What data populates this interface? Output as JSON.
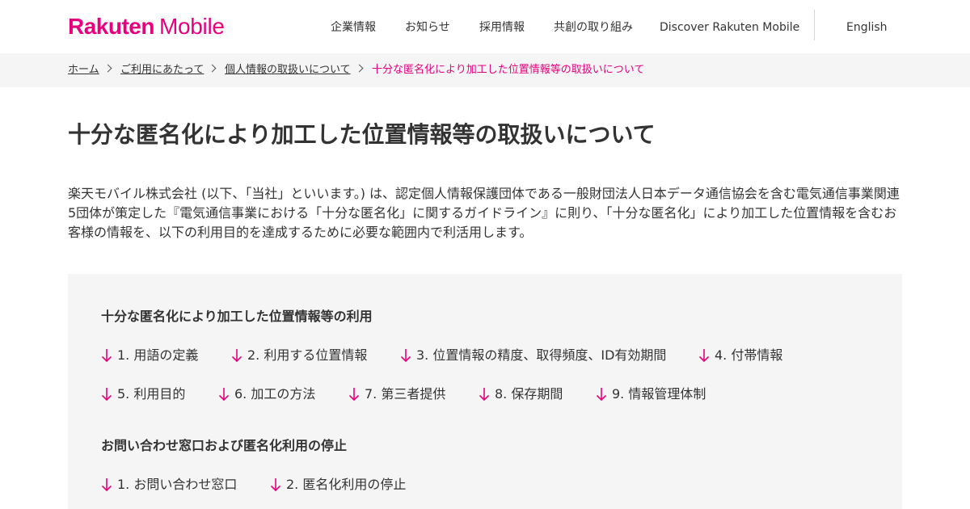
{
  "header": {
    "logo_brand": "Rakuten",
    "logo_product": "Mobile",
    "nav": [
      {
        "label": "企業情報"
      },
      {
        "label": "お知らせ"
      },
      {
        "label": "採用情報"
      },
      {
        "label": "共創の取り組み"
      },
      {
        "label": "Discover Rakuten Mobile"
      },
      {
        "label": "English"
      }
    ]
  },
  "breadcrumb": {
    "items": [
      {
        "label": "ホーム"
      },
      {
        "label": "ご利用にあたって"
      },
      {
        "label": "個人情報の取扱いについて"
      }
    ],
    "current": "十分な匿名化により加工した位置情報等の取扱いについて"
  },
  "page": {
    "title": "十分な匿名化により加工した位置情報等の取扱いについて",
    "intro": "楽天モバイル株式会社 (以下、「当社」といいます。) は、認定個人情報保護団体である一般財団法人日本データ通信協会を含む電気通信事業関連5団体が策定した『電気通信事業における「十分な匿名化」に関するガイドライン』に則り、「十分な匿名化」により加工した位置情報を含むお客様の情報を、以下の利用目的を達成するために必要な範囲内で利活用します。"
  },
  "toc": {
    "section1_heading": "十分な匿名化により加工した位置情報等の利用",
    "section1_links": [
      {
        "label": "1. 用語の定義"
      },
      {
        "label": "2. 利用する位置情報"
      },
      {
        "label": "3. 位置情報の精度、取得頻度、ID有効期間"
      },
      {
        "label": "4. 付帯情報"
      },
      {
        "label": "5. 利用目的"
      },
      {
        "label": "6. 加工の方法"
      },
      {
        "label": "7. 第三者提供"
      },
      {
        "label": "8. 保存期間"
      },
      {
        "label": "9. 情報管理体制"
      }
    ],
    "section2_heading": "お問い合わせ窓口および匿名化利用の停止",
    "section2_links": [
      {
        "label": "1. お問い合わせ窓口"
      },
      {
        "label": "2. 匿名化利用の停止"
      }
    ]
  },
  "colors": {
    "brand": "#e6007e",
    "text": "#333333",
    "panel": "#f5f5f5"
  }
}
